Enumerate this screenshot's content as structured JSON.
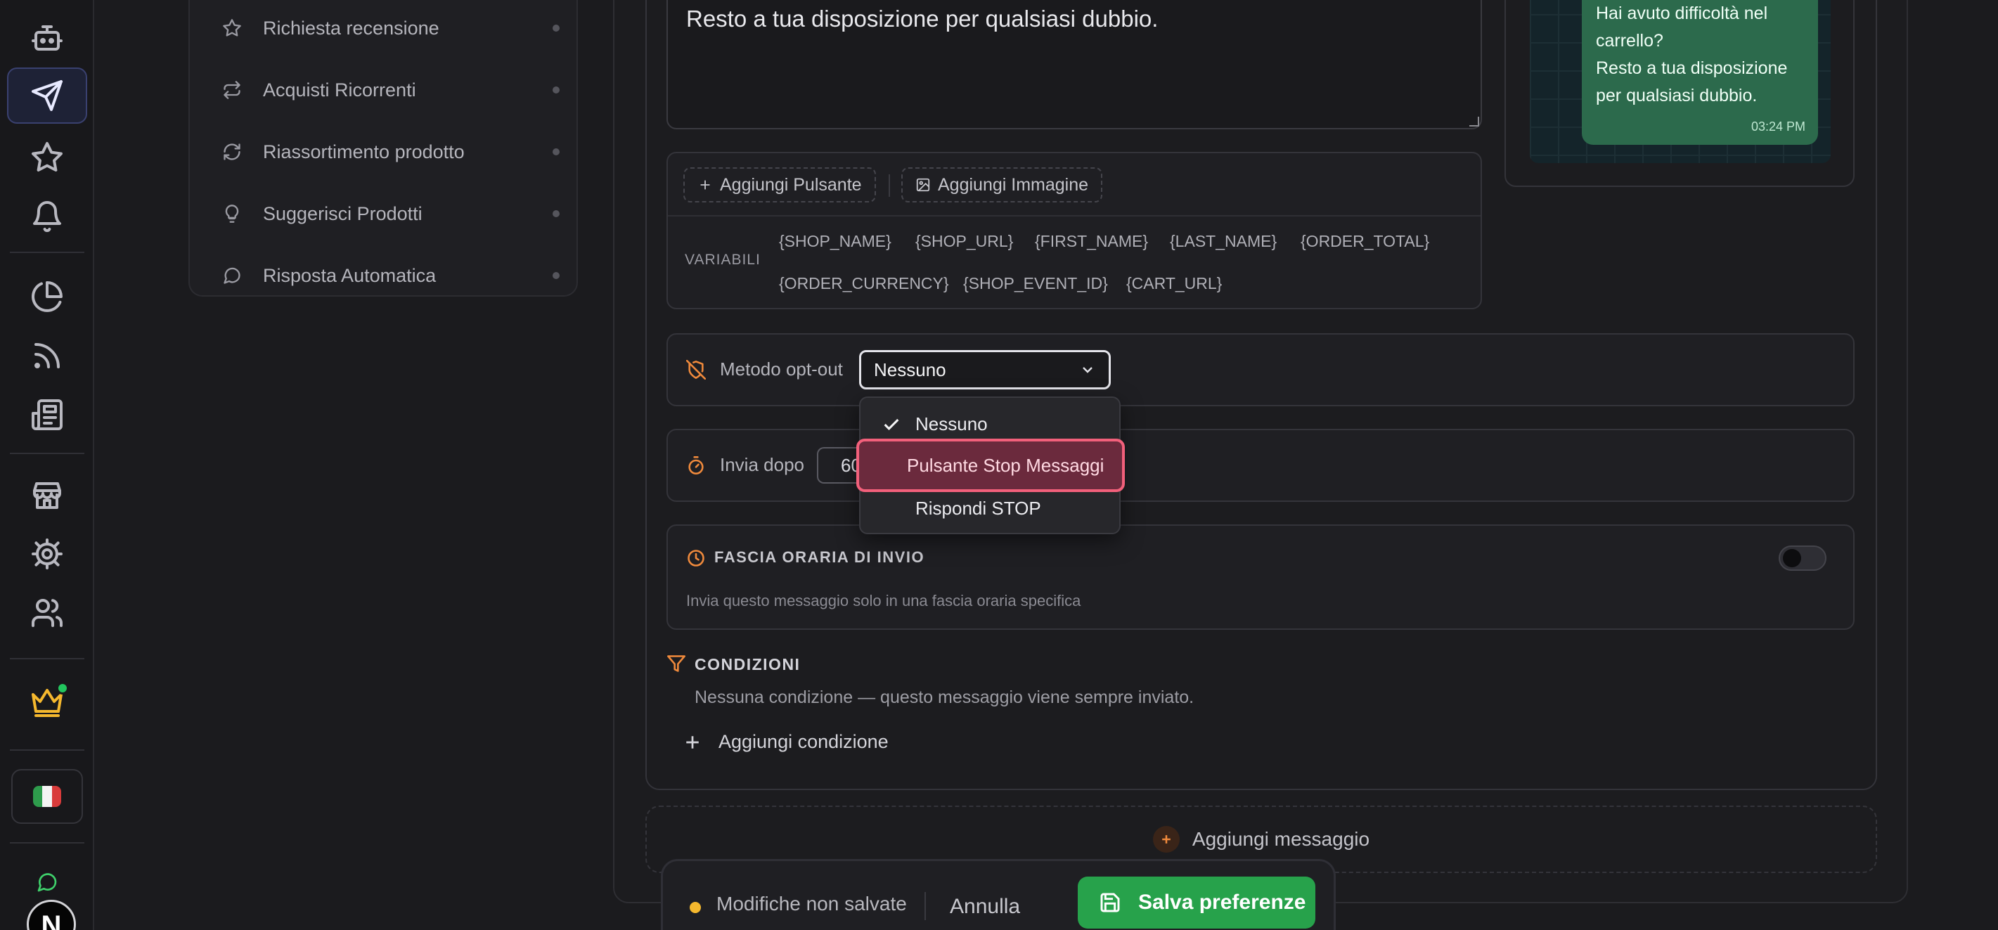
{
  "sidebar_nav": {
    "items": [
      "bot-icon",
      "send-icon",
      "star-icon",
      "bell-icon",
      "pie-chart-icon",
      "rss-icon",
      "newspaper-icon",
      "store-icon",
      "settings-icon",
      "users-icon",
      "crown-icon"
    ],
    "active": "send-icon"
  },
  "sub_menu": {
    "items": [
      {
        "label": "Richiesta recensione",
        "icon": "star-icon"
      },
      {
        "label": "Acquisti Ricorrenti",
        "icon": "repeat-icon"
      },
      {
        "label": "Riassortimento prodotto",
        "icon": "refresh-icon"
      },
      {
        "label": "Suggerisci Prodotti",
        "icon": "lightbulb-icon"
      },
      {
        "label": "Risposta Automatica",
        "icon": "message-icon"
      }
    ]
  },
  "editor": {
    "message_text": "Resto a tua disposizione per qualsiasi dubbio.",
    "add_button_label": "Aggiungi Pulsante",
    "add_image_label": "Aggiungi Immagine",
    "variables_label": "VARIABILI",
    "variables": [
      "{SHOP_NAME}",
      "{SHOP_URL}",
      "{FIRST_NAME}",
      "{LAST_NAME}",
      "{ORDER_TOTAL}",
      "{ORDER_CURRENCY}",
      "{SHOP_EVENT_ID}",
      "{CART_URL}"
    ]
  },
  "preview": {
    "message": "Hai avuto difficoltà nel carrello?\nResto a tua disposizione per qualsiasi dubbio.",
    "time": "03:24 PM"
  },
  "optout": {
    "label": "Metodo opt-out",
    "selected": "Nessuno",
    "options": [
      "Nessuno",
      "Pulsante Stop Messaggi",
      "Rispondi STOP"
    ],
    "highlighted": "Pulsante Stop Messaggi"
  },
  "send_after": {
    "label": "Invia dopo",
    "value": "60"
  },
  "time_window": {
    "title": "FASCIA ORARIA DI INVIO",
    "description": "Invia questo messaggio solo in una fascia oraria specifica",
    "enabled": false
  },
  "conditions": {
    "title": "CONDIZIONI",
    "empty_text": "Nessuna condizione — questo messaggio viene sempre inviato.",
    "add_label": "Aggiungi condizione"
  },
  "add_message_label": "Aggiungi messaggio",
  "bottom_bar": {
    "unsaved_label": "Modifiche non salvate",
    "cancel_label": "Annulla",
    "save_label": "Salva preferenze"
  },
  "colors": {
    "accent_orange": "#f08a3c",
    "save_green": "#27a24b",
    "highlight_pink": "#f2607b",
    "unsaved_yellow": "#f5b82e"
  }
}
